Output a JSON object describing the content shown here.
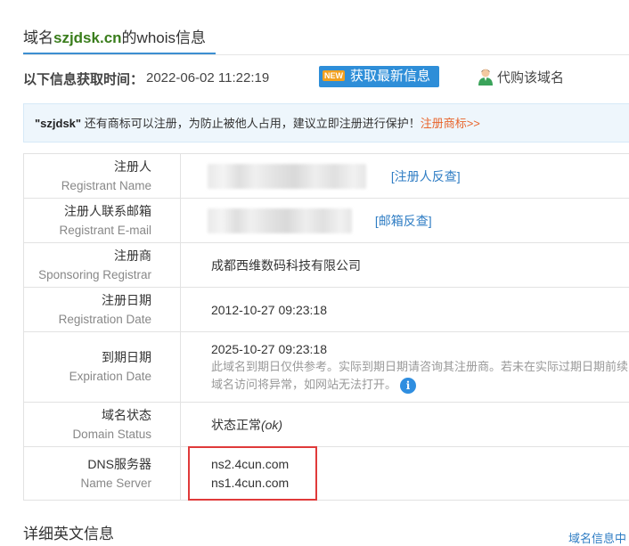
{
  "header": {
    "title_prefix": "域名",
    "domain": "szjdsk.cn",
    "title_suffix": "的whois信息"
  },
  "fetch": {
    "label": "以下信息获取时间：",
    "time": "2022-06-02 11:22:19",
    "new_badge": "NEW",
    "refresh_label": "获取最新信息",
    "agent_label": "代购该域名"
  },
  "notice": {
    "keyword": "\"szjdsk\"",
    "text": " 还有商标可以注册，为防止被他人占用，建议立即注册进行保护！",
    "link": "注册商标>>"
  },
  "rows": {
    "registrant": {
      "zh": "注册人",
      "en": "Registrant Name",
      "link": "[注册人反查]"
    },
    "email": {
      "zh": "注册人联系邮箱",
      "en": "Registrant E-mail",
      "link": "[邮箱反查]"
    },
    "registrar": {
      "zh": "注册商",
      "en": "Sponsoring Registrar",
      "value": "成都西维数码科技有限公司"
    },
    "reg_date": {
      "zh": "注册日期",
      "en": "Registration Date",
      "value": "2012-10-27 09:23:18"
    },
    "exp_date": {
      "zh": "到期日期",
      "en": "Expiration Date",
      "value": "2025-10-27 09:23:18",
      "note1": "此域名到期日仅供参考。实际到期日期请咨询其注册商。若未在实际过期日期前续",
      "note2": "域名访问将异常，如网站无法打开。"
    },
    "status": {
      "zh": "域名状态",
      "en": "Domain Status",
      "value_zh": "状态正常",
      "value_code": "(ok)"
    },
    "dns": {
      "zh": "DNS服务器",
      "en": "Name Server",
      "ns1": "ns2.4cun.com",
      "ns2": "ns1.4cun.com"
    }
  },
  "footer": {
    "detail_title": "详细英文信息",
    "side_link": "域名信息中"
  },
  "colors": {
    "brand_blue": "#2e8ed8",
    "domain_green": "#3a7d1c",
    "link_blue": "#2f7dc4",
    "highlight_red": "#e03a3a",
    "notice_orange": "#e8642b"
  }
}
